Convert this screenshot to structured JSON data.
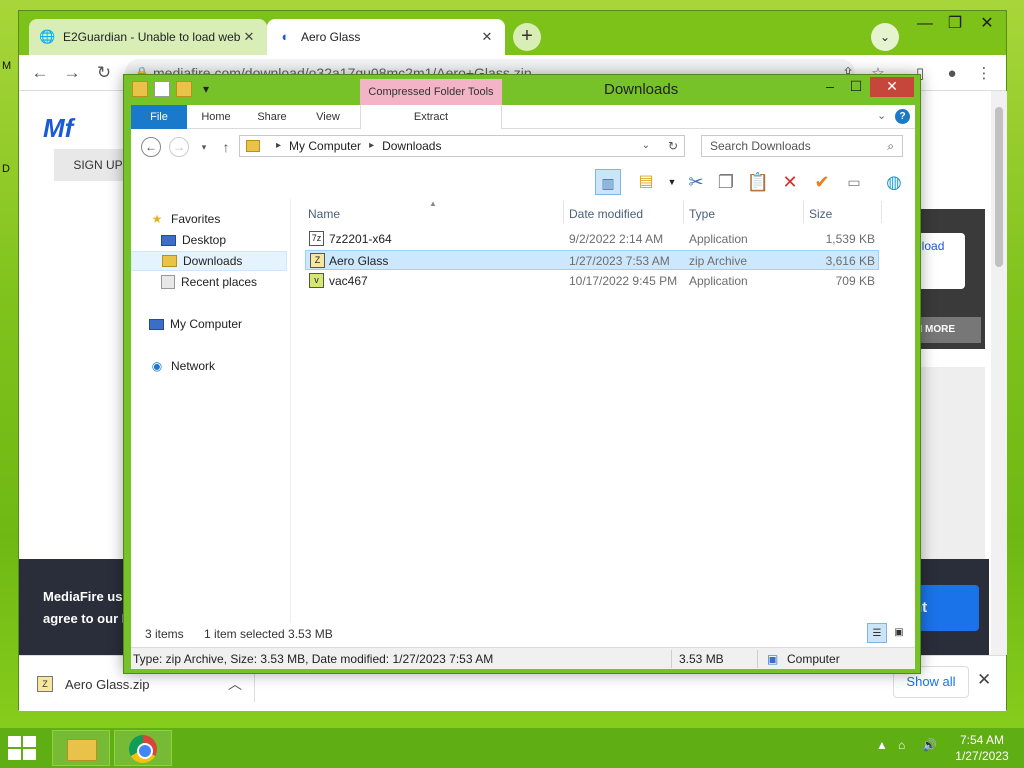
{
  "desktop": {
    "label_m": "M",
    "label_d": "D"
  },
  "chrome": {
    "tabs": [
      {
        "title": "E2Guardian - Unable to load web",
        "close": "✕"
      },
      {
        "title": "Aero Glass",
        "close": "✕"
      }
    ],
    "new_tab": "+",
    "tab_search": "⌄",
    "window_controls": {
      "minimize": "—",
      "maximize": "❐",
      "close": "✕"
    },
    "url": "mediafire.com/download/o32a17qu08mc2m1/Aero+Glass.zip",
    "page": {
      "logo": "Mf",
      "signup": "SIGN UP",
      "download_snippet": "nload",
      "more_snippet": "N MORE",
      "cookie_line1": "MediaFire use",
      "cookie_line2": "agree to our F",
      "accept_snippet": "nt"
    },
    "download_bar": {
      "file": "Aero Glass.zip",
      "show_all": "Show all",
      "close": "✕"
    }
  },
  "explorer": {
    "title": "Downloads",
    "contextual_tab": "Compressed Folder Tools",
    "ribbon_tabs": [
      "File",
      "Home",
      "Share",
      "View"
    ],
    "contextual_sub": "Extract",
    "address": {
      "root": "My Computer",
      "current": "Downloads"
    },
    "search_placeholder": "Search Downloads",
    "nav": {
      "favorites": "Favorites",
      "desktop": "Desktop",
      "downloads": "Downloads",
      "recent": "Recent places",
      "computer": "My Computer",
      "network": "Network"
    },
    "columns": {
      "name": "Name",
      "date": "Date modified",
      "type": "Type",
      "size": "Size"
    },
    "files": [
      {
        "name": "7z2201-x64",
        "date": "9/2/2022 2:14 AM",
        "type": "Application",
        "size": "1,539 KB",
        "icon": "app",
        "glyph": "7z"
      },
      {
        "name": "Aero Glass",
        "date": "1/27/2023 7:53 AM",
        "type": "zip Archive",
        "size": "3,616 KB",
        "icon": "zip",
        "glyph": "Z"
      },
      {
        "name": "vac467",
        "date": "10/17/2022 9:45 PM",
        "type": "Application",
        "size": "709 KB",
        "icon": "vac",
        "glyph": "v"
      }
    ],
    "status": {
      "count": "3 items",
      "selected": "1 item selected  3.53 MB"
    },
    "statusbar": {
      "details": "Type: zip Archive, Size: 3.53 MB, Date modified: 1/27/2023 7:53 AM",
      "size": "3.53 MB",
      "location": "Computer"
    }
  },
  "taskbar": {
    "time": "7:54 AM",
    "date": "1/27/2023"
  }
}
